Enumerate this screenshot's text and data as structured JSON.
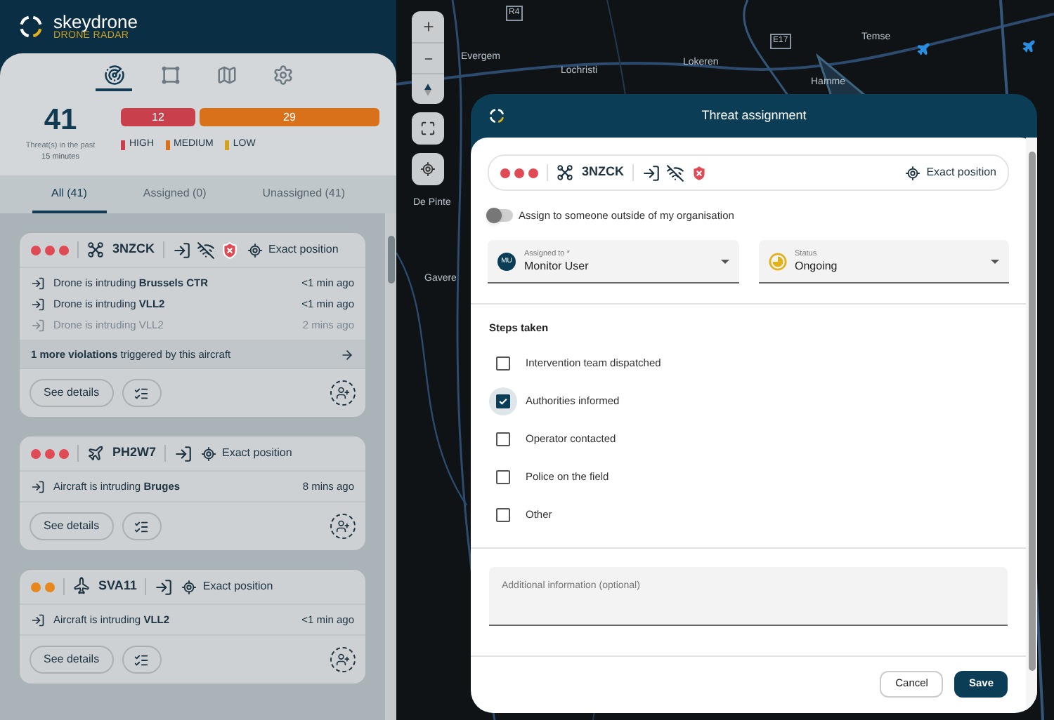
{
  "app": {
    "brand": "skeydrone",
    "subtitle": "DRONE RADAR"
  },
  "nav_tabs": [
    {
      "kind": "radar",
      "selected": true
    },
    {
      "kind": "zones",
      "selected": false
    },
    {
      "kind": "map",
      "selected": false
    },
    {
      "kind": "settings",
      "selected": false
    }
  ],
  "summary": {
    "count": "41",
    "caption": "Threat(s) in the past",
    "period": "15 minutes",
    "bars": [
      {
        "label": "12",
        "color": "#c8404b"
      },
      {
        "label": "29",
        "color": "#d9711a"
      }
    ],
    "legend": [
      {
        "label": "HIGH",
        "color": "#c8404b"
      },
      {
        "label": "MEDIUM",
        "color": "#d9711a"
      },
      {
        "label": "LOW",
        "color": "#d4a21c"
      }
    ]
  },
  "filter_tabs": [
    {
      "label": "All (41)",
      "selected": true
    },
    {
      "label": "Assigned (0)",
      "selected": false
    },
    {
      "label": "Unassigned (41)",
      "selected": false
    }
  ],
  "threats": [
    {
      "kind": "drone",
      "id": "3NZCK",
      "dots": [
        {
          "color": "#e04a55"
        },
        {
          "color": "#e04a55"
        },
        {
          "color": "#e04a55"
        }
      ],
      "flags": [
        {
          "kind": "intrusion"
        },
        {
          "kind": "no-remote-id"
        },
        {
          "kind": "alert"
        }
      ],
      "position": "Exact position",
      "violations": [
        {
          "text": "Drone is intruding **Brussels CTR**",
          "time": "<1 min ago",
          "faded": false
        },
        {
          "text": "Drone is intruding **VLL2**",
          "time": "<1 min ago",
          "faded": false
        },
        {
          "text": "Drone is intruding VLL2",
          "time": "2 mins ago",
          "faded": true
        }
      ],
      "more": "**1 more violations** triggered by this aircraft",
      "details": "See details"
    },
    {
      "kind": "aircraft",
      "id": "PH2W7",
      "dots": [
        {
          "color": "#e04a55"
        },
        {
          "color": "#e04a55"
        },
        {
          "color": "#e04a55"
        }
      ],
      "flags": [
        {
          "kind": "intrusion"
        }
      ],
      "position": "Exact position",
      "violations": [
        {
          "text": "Aircraft is intruding **Bruges**",
          "time": "8 mins ago",
          "faded": false
        }
      ],
      "details": "See details"
    },
    {
      "kind": "jet",
      "id": "SVA11",
      "dots": [
        {
          "color": "#e8871e"
        },
        {
          "color": "#e8871e"
        }
      ],
      "flags": [
        {
          "kind": "intrusion"
        }
      ],
      "position": "Exact position",
      "violations": [
        {
          "text": "Aircraft is intruding **VLL2**",
          "time": "<1 min ago",
          "faded": false
        }
      ],
      "details": "See details"
    }
  ],
  "map": {
    "labels": [
      "Evergem",
      "Lochristi",
      "Lokeren",
      "Hamme",
      "Temse",
      "De Pinte",
      "Gavere"
    ],
    "roads": [
      "R4",
      "E17"
    ]
  },
  "modal": {
    "title": "Threat assignment",
    "threat": {
      "kind": "drone",
      "id": "3NZCK",
      "dots": [
        {
          "color": "#e04a55"
        },
        {
          "color": "#e04a55"
        },
        {
          "color": "#e04a55"
        }
      ],
      "flags": [
        {
          "kind": "intrusion"
        },
        {
          "kind": "no-remote-id"
        },
        {
          "kind": "alert"
        }
      ],
      "position": "Exact position"
    },
    "toggle": {
      "label": "Assign to someone outside of my organisation",
      "on": false
    },
    "assigned": {
      "label": "Assigned to *",
      "value": "Monitor User",
      "avatar": "MU"
    },
    "status": {
      "label": "Status",
      "value": "Ongoing"
    },
    "steps": {
      "heading": "Steps taken",
      "items": [
        {
          "label": "Intervention team dispatched",
          "checked": false
        },
        {
          "label": "Authorities informed",
          "checked": true
        },
        {
          "label": "Operator contacted",
          "checked": false
        },
        {
          "label": "Police on the field",
          "checked": false
        },
        {
          "label": "Other",
          "checked": false
        }
      ]
    },
    "notes": {
      "placeholder": "Additional information (optional)"
    },
    "buttons": {
      "cancel": "Cancel",
      "save": "Save"
    }
  }
}
